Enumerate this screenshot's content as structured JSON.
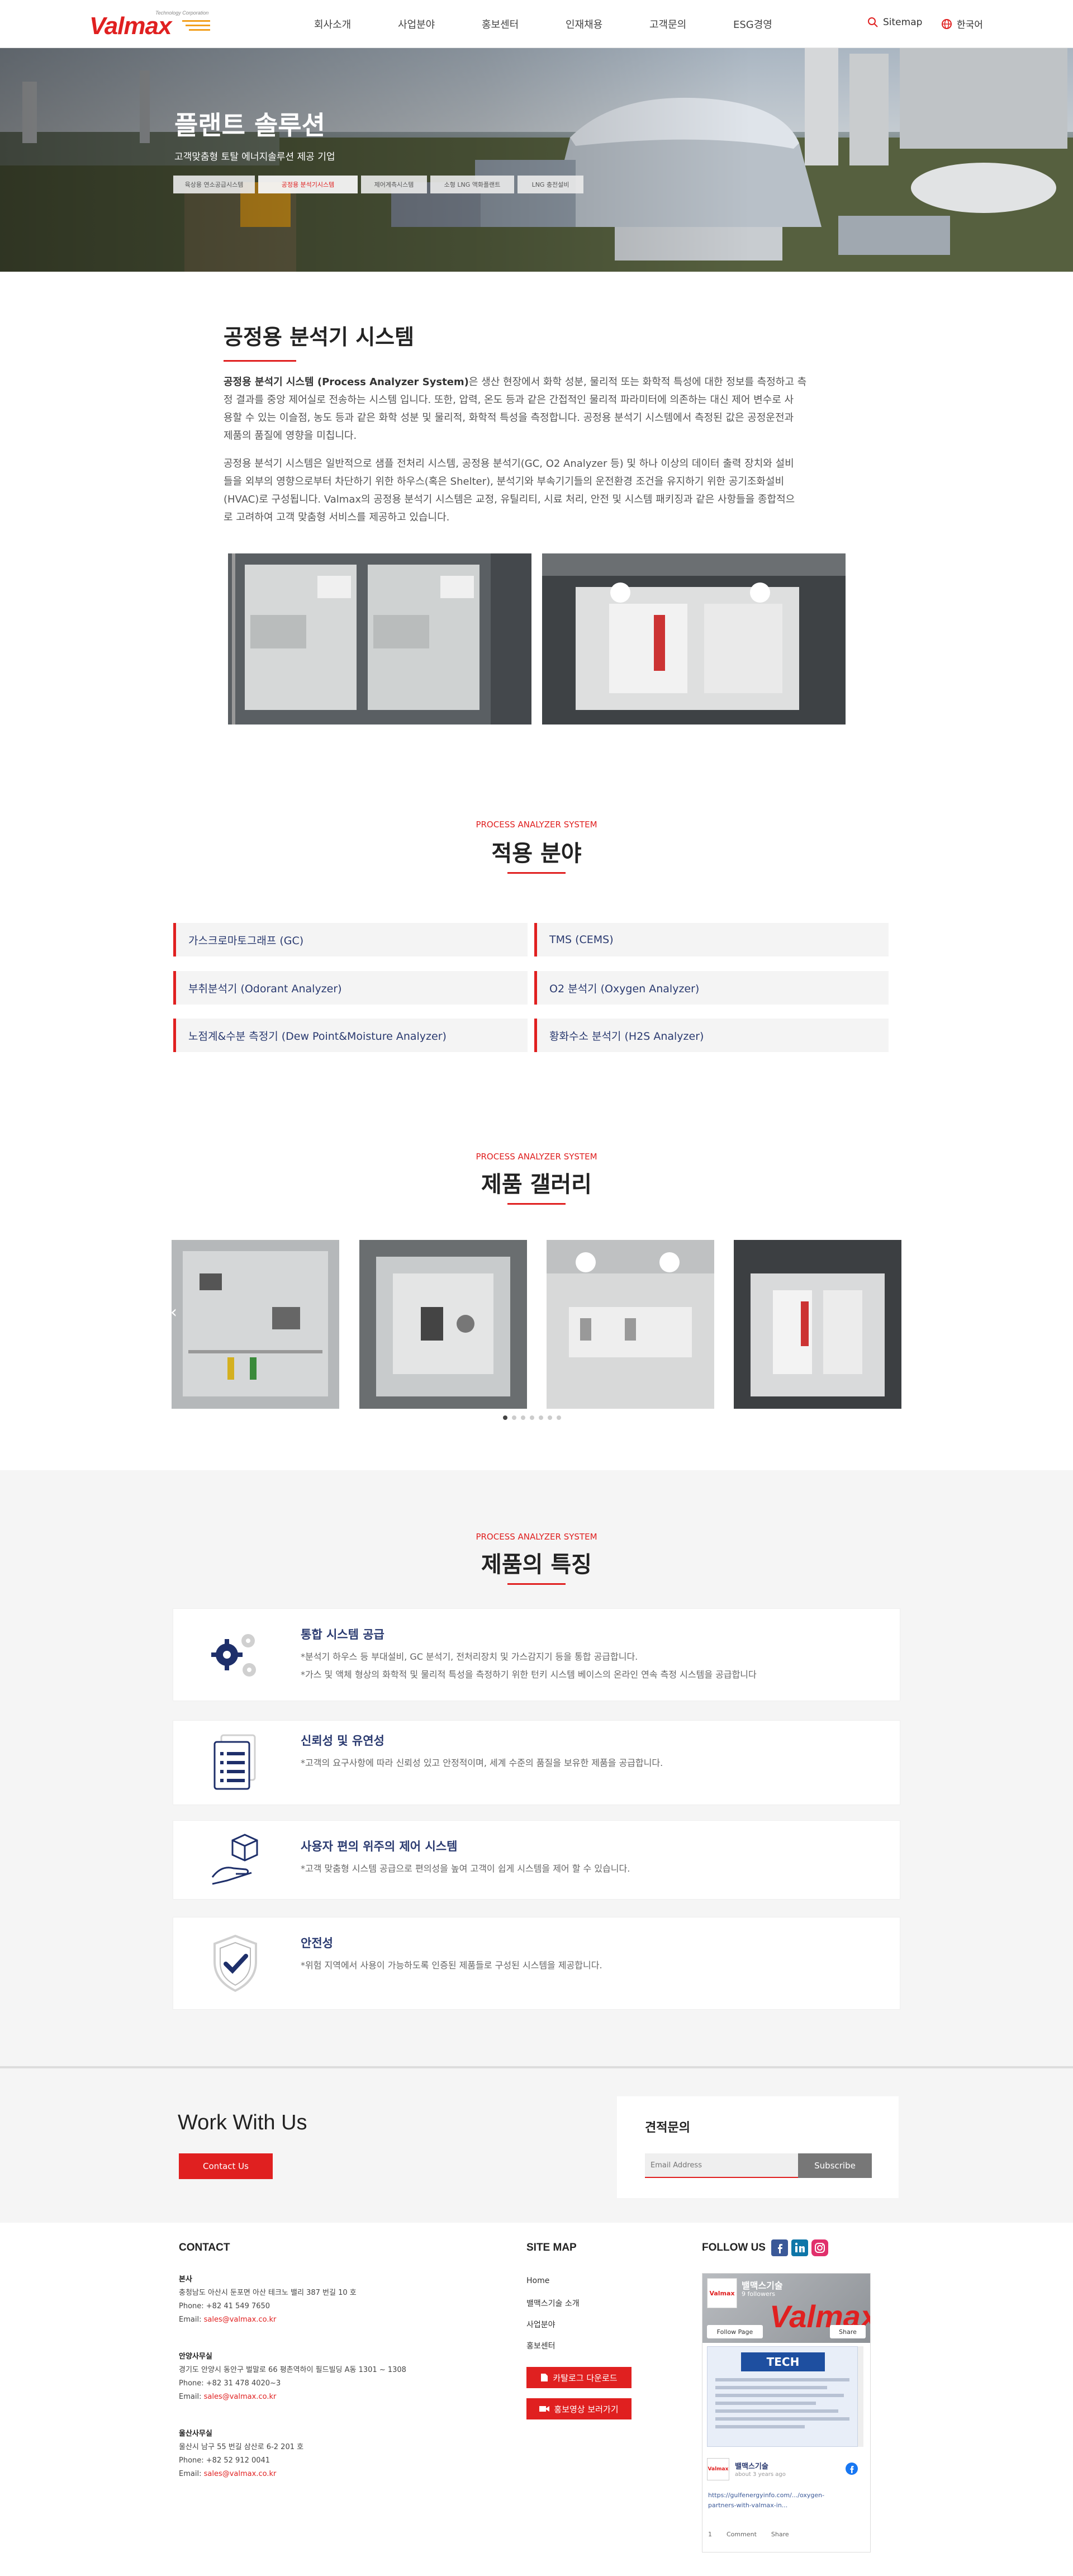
{
  "header": {
    "logo_text": "Valmax",
    "logo_tagline": "Technology Corporation",
    "nav": [
      "회사소개",
      "사업분야",
      "홍보센터",
      "인재채용",
      "고객문의",
      "ESG경영"
    ],
    "sitemap_label": "Sitemap",
    "language_label": "한국어"
  },
  "hero": {
    "title": "플랜트 솔루션",
    "subtitle": "고객맞춤형 토탈 에너지솔루션 제공 기업",
    "tabs": [
      "육상용 연소공급시스템",
      "공정용 분석기시스템",
      "제어계측시스템",
      "소형 LNG 액화플랜트",
      "LNG 충전설비"
    ],
    "active_tab": 1
  },
  "intro": {
    "title": "공정용 분석기 시스템",
    "p1_bold": "공정용 분석기 시스템 (Process Analyzer System)",
    "p1_line1_rest": "은 생산 현장에서 화학 성분, 물리적 또는 화학적 특성에 대한 정보를 측정하고 측",
    "p1_line2": "정 결과를 중앙 제어실로 전송하는 시스템 입니다. 또한, 압력, 온도 등과 같은 간접적인 물리적 파라미터에 의존하는 대신 제어 변수로 사",
    "p1_line3": "용할 수 있는 이슬점, 농도 등과 같은 화학 성분 및 물리적, 화학적 특성을 측정합니다. 공정용 분석기 시스템에서 측정된 값은 공정운전과",
    "p1_line4": "제품의 품질에 영향을 미칩니다.",
    "p2_line1": "공정용 분석기 시스템은 일반적으로 샘플 전처리 시스템, 공정용 분석기(GC, O2 Analyzer 등) 및 하나 이상의 데이터 출력 장치와 설비",
    "p2_line2": "들을 외부의 영향으로부터 차단하기 위한 하우스(혹은 Shelter), 분석기와 부속기기들의 운전환경 조건을 유지하기 위한 공기조화설비",
    "p2_line3": "(HVAC)로 구성됩니다. Valmax의 공정용 분석기 시스템은 교정, 유틸리티, 시료 처리, 안전 및 시스템 패키징과 같은 사항들을 종합적으",
    "p2_line4": "로 고려하여 고객 맞춤형 서비스를 제공하고 있습니다."
  },
  "applications": {
    "eyebrow": "PROCESS ANALYZER SYSTEM",
    "title": "적용 분야",
    "items": [
      "가스크로마토그래프 (GC)",
      "TMS (CEMS)",
      "부취분석기 (Odorant Analyzer)",
      "O2 분석기 (Oxygen Analyzer)",
      "노점계&수분 측정기 (Dew Point&Moisture Analyzer)",
      "황화수소 분석기 (H2S Analyzer)"
    ]
  },
  "gallery": {
    "eyebrow": "PROCESS ANALYZER SYSTEM",
    "title": "제품 갤러리",
    "prev_label": "‹",
    "dots": 7,
    "active_dot": 0
  },
  "features": {
    "eyebrow": "PROCESS ANALYZER SYSTEM",
    "title": "제품의 특징",
    "items": [
      {
        "title": "통합 시스템 공급",
        "lines": [
          "*분석기 하우스 등 부대설비, GC 분석기, 전처리장치 및 가스감지기 등을 통합 공급합니다.",
          "*가스 및 액체 형상의 화학적 및 물리적 특성을 측정하기 위한 턴키 시스템 베이스의 온라인 연속 측정 시스템을 공급합니다"
        ],
        "icon": "gears-icon"
      },
      {
        "title": "신뢰성 및 유연성",
        "lines": [
          "*고객의 요구사항에 따라 신뢰성 있고 안정적이며, 세계 수준의 품질을 보유한 제품을 공급합니다."
        ],
        "icon": "document-list-icon"
      },
      {
        "title": "사용자 편의 위주의 제어 시스템",
        "lines": [
          "*고객 맞춤형 시스템 공급으로 편의성을 높여 고객이 쉽게 시스템을 제어 할 수 있습니다."
        ],
        "icon": "hand-box-icon"
      },
      {
        "title": "안전성",
        "lines": [
          "*위험 지역에서 사용이 가능하도록 인증된 제품들로 구성된 시스템을 제공합니다."
        ],
        "icon": "shield-check-icon"
      }
    ]
  },
  "cta": {
    "title": "Work With Us",
    "button": "Contact Us",
    "quote_title": "견적문의",
    "email_placeholder": "Email Address",
    "subscribe": "Subscribe"
  },
  "footer": {
    "contact_heading": "CONTACT",
    "offices": [
      {
        "name": "본사",
        "address": "충청남도 아산시 둔포면 아산 테크노 밸리 387 번길 10 호",
        "phone": "Phone: +82 41 549 7650",
        "email_label": "Email: ",
        "email": "sales@valmax.co.kr"
      },
      {
        "name": "안양사무실",
        "address": "경기도 안양시 동안구 벌말로 66 평촌역하이 필드빌딩 A동 1301 ~ 1308",
        "phone": "Phone: +82 31 478 4020~3",
        "email_label": "Email: ",
        "email": "sales@valmax.co.kr"
      },
      {
        "name": "울산사무실",
        "address": "울산시 남구 55 번길 삼산로 6-2 201 호",
        "phone": "Phone: +82 52 912 0041",
        "email_label": "Email: ",
        "email": "sales@valmax.co.kr"
      }
    ],
    "sitemap_heading": "SITE MAP",
    "sitemap_links": [
      "Home",
      "밸맥스기술 소개",
      "사업분야",
      "홍보센터"
    ],
    "catalog_button": "카탈로그 다운로드",
    "video_button": "홍보영상 보러가기",
    "follow_heading": "FOLLOW US",
    "fb_page_name": "밸맥스기술",
    "fb_followers": "9 followers",
    "fb_follow": "Follow Page",
    "fb_share": "Share",
    "fb_post_name": "밸맥스기술",
    "fb_post_time": "about 3 years ago",
    "fb_post_link1": "https://gulfenergyinfo.com/.../oxygen-",
    "fb_post_link2": "partners-with-valmax-in...",
    "fb_likes": "1",
    "fb_comment": "Comment",
    "fb_share2": "Share",
    "fb_tech_banner": "TECH"
  },
  "colors": {
    "accent": "#e02020",
    "navy": "#2a3a70",
    "grey_bg": "#f5f5f5"
  }
}
